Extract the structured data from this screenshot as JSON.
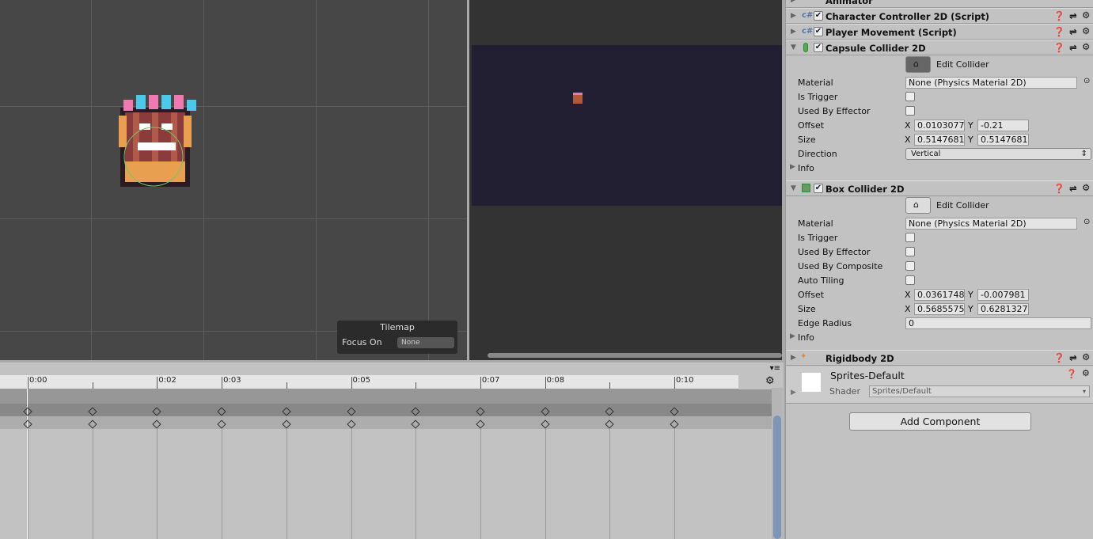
{
  "tilemap": {
    "title": "Tilemap",
    "focus_label": "Focus On",
    "focus_value": "None"
  },
  "timeline": {
    "frames": [
      0,
      1,
      2,
      3,
      4,
      5,
      6,
      7,
      8,
      9,
      10
    ],
    "labels": [
      {
        "frame": 0,
        "text": "0:00"
      },
      {
        "frame": 2,
        "text": "0:02"
      },
      {
        "frame": 3,
        "text": "0:03"
      },
      {
        "frame": 5,
        "text": "0:05"
      },
      {
        "frame": 7,
        "text": "0:07"
      },
      {
        "frame": 8,
        "text": "0:08"
      },
      {
        "frame": 10,
        "text": "0:10"
      }
    ]
  },
  "inspector": {
    "animator": "Animator",
    "char_ctrl": "Character Controller 2D (Script)",
    "player_mv": "Player Movement (Script)",
    "capsule": {
      "title": "Capsule Collider 2D",
      "edit": "Edit Collider",
      "material_label": "Material",
      "material": "None (Physics Material 2D)",
      "trigger": "Is Trigger",
      "effector": "Used By Effector",
      "offset": "Offset",
      "offset_x": "0.0103077",
      "offset_y": "-0.21",
      "size": "Size",
      "size_x": "0.5147681",
      "size_y": "0.5147681",
      "direction_label": "Direction",
      "direction": "Vertical",
      "info": "Info"
    },
    "box": {
      "title": "Box Collider 2D",
      "edit": "Edit Collider",
      "material_label": "Material",
      "material": "None (Physics Material 2D)",
      "trigger": "Is Trigger",
      "effector": "Used By Effector",
      "composite": "Used By Composite",
      "tiling": "Auto Tiling",
      "offset": "Offset",
      "offset_x": "0.0361748",
      "offset_y": "-0.007981",
      "size": "Size",
      "size_x": "0.5685575",
      "size_y": "0.6281327",
      "edge_label": "Edge Radius",
      "edge": "0",
      "info": "Info"
    },
    "rigidbody": "Rigidbody 2D",
    "material": {
      "name": "Sprites-Default",
      "shader_label": "Shader",
      "shader": "Sprites/Default"
    },
    "add_component": "Add Component",
    "x": "X",
    "y": "Y"
  }
}
